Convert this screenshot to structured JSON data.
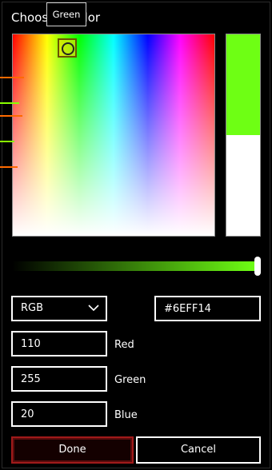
{
  "dialog": {
    "title": "Choose a color"
  },
  "tooltip": {
    "text": "Green"
  },
  "picker": {
    "selected_color": "#6EFF14",
    "value_level_percent": 100
  },
  "mode": {
    "selected": "RGB",
    "chevron_icon": "chevron-down-icon"
  },
  "hex_field": {
    "value": "#6EFF14"
  },
  "channels": [
    {
      "label": "Red",
      "value": "110"
    },
    {
      "label": "Green",
      "value": "255"
    },
    {
      "label": "Blue",
      "value": "20"
    }
  ],
  "buttons": {
    "done": "Done",
    "cancel": "Cancel"
  },
  "colors": {
    "background": "#000000",
    "preview": "#6EFF14",
    "done_border": "#A01A1A"
  }
}
